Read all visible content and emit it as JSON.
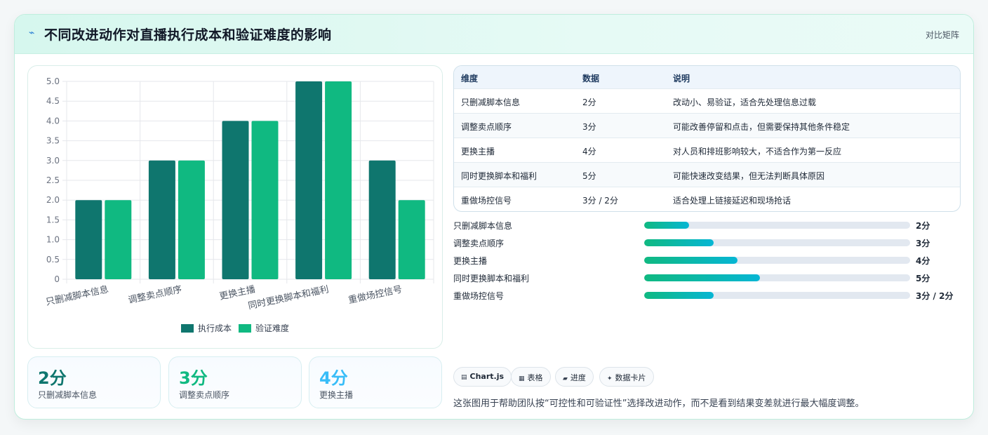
{
  "header": {
    "icon": "lightning-icon",
    "title": "不同改进动作对直播执行成本和验证难度的影响",
    "tag": "对比矩阵"
  },
  "colors": {
    "series1": "#0f766e",
    "series2": "#10b981",
    "stat1": "#0f766e",
    "stat2": "#10b981",
    "stat3": "#38bdf8"
  },
  "chart_data": {
    "type": "bar",
    "categories": [
      "只删减脚本信息",
      "调整卖点顺序",
      "更换主播",
      "同时更换脚本和福利",
      "重做场控信号"
    ],
    "series": [
      {
        "name": "执行成本",
        "values": [
          2,
          3,
          4,
          5,
          3
        ]
      },
      {
        "name": "验证难度",
        "values": [
          2,
          3,
          4,
          5,
          2
        ]
      }
    ],
    "ylim": [
      0,
      5
    ],
    "yticks": [
      "0",
      "0.5",
      "1.0",
      "1.5",
      "2.0",
      "2.5",
      "3.0",
      "3.5",
      "4.0",
      "4.5",
      "5.0"
    ],
    "grid": true,
    "legend": "bottom"
  },
  "stats": [
    {
      "value": "2分",
      "label": "只删减脚本信息"
    },
    {
      "value": "3分",
      "label": "调整卖点顺序"
    },
    {
      "value": "4分",
      "label": "更换主播"
    }
  ],
  "table": {
    "headers": [
      "维度",
      "数据",
      "说明"
    ],
    "rows": [
      [
        "只删减脚本信息",
        "2分",
        "改动小、易验证，适合先处理信息过载"
      ],
      [
        "调整卖点顺序",
        "3分",
        "可能改善停留和点击，但需要保持其他条件稳定"
      ],
      [
        "更换主播",
        "4分",
        "对人员和排班影响较大，不适合作为第一反应"
      ],
      [
        "同时更换脚本和福利",
        "5分",
        "可能快速改变结果，但无法判断具体原因"
      ],
      [
        "重做场控信号",
        "3分 / 2分",
        "适合处理上链接延迟和现场抢话"
      ]
    ]
  },
  "progress": [
    {
      "label": "只删减脚本信息",
      "value": "2分",
      "fraction": 0.17
    },
    {
      "label": "调整卖点顺序",
      "value": "3分",
      "fraction": 0.26
    },
    {
      "label": "更换主播",
      "value": "4分",
      "fraction": 0.35
    },
    {
      "label": "同时更换脚本和福利",
      "value": "5分",
      "fraction": 0.435
    },
    {
      "label": "重做场控信号",
      "value": "3分 / 2分",
      "fraction": 0.26
    }
  ],
  "chips": [
    {
      "icon": "chart-icon",
      "glyph": "▤",
      "label": "Chart.js"
    },
    {
      "icon": "table-icon",
      "glyph": "▦",
      "label": "表格"
    },
    {
      "icon": "progress-icon",
      "glyph": "▰",
      "label": "进度"
    },
    {
      "icon": "sparkle-icon",
      "glyph": "✦",
      "label": "数据卡片"
    }
  ],
  "note": "这张图用于帮助团队按“可控性和可验证性”选择改进动作，而不是看到结果变差就进行最大幅度调整。"
}
